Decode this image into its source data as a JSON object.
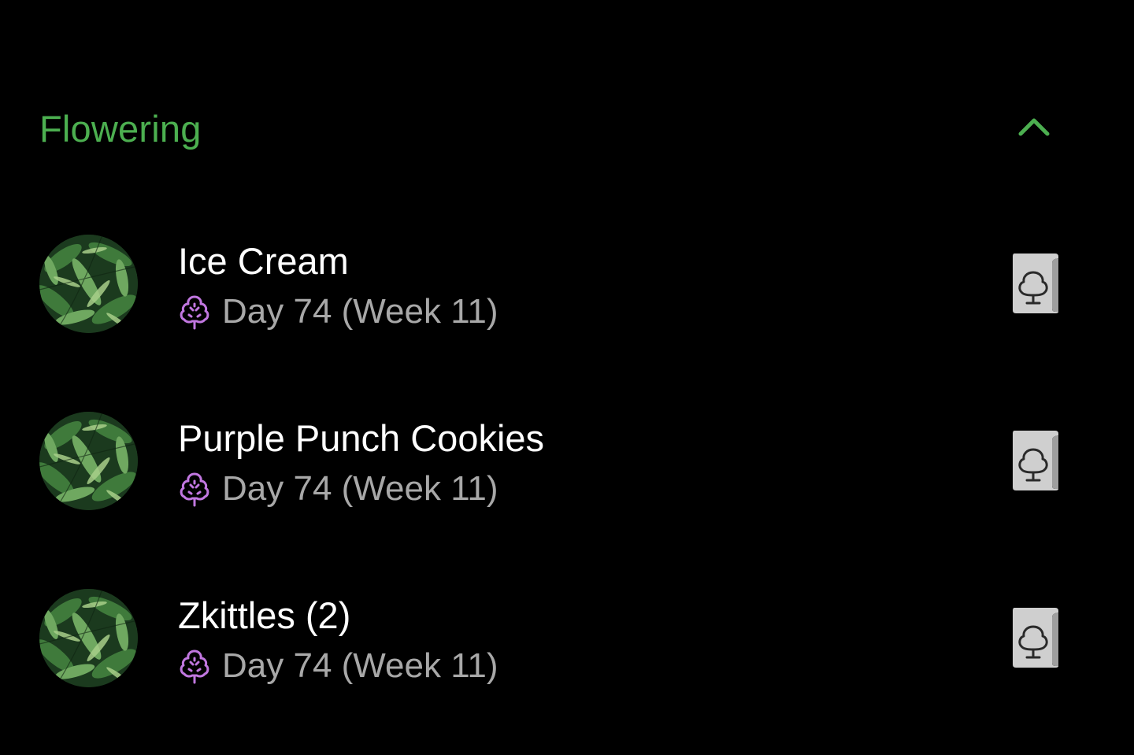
{
  "colors": {
    "background": "#000000",
    "accent_green": "#4caf50",
    "flowering_purple": "#c177e0",
    "secondary_text": "#a8a8a8",
    "diary_icon": "#cfcfcf"
  },
  "section": {
    "title": "Flowering",
    "toggle_icon": "chevron-up-icon"
  },
  "plants": [
    {
      "name": "Ice Cream",
      "status": "Day 74 (Week 11)",
      "stage_icon": "flowering-tree-icon",
      "action_icon": "diary-book-icon"
    },
    {
      "name": "Purple Punch Cookies",
      "status": "Day 74 (Week 11)",
      "stage_icon": "flowering-tree-icon",
      "action_icon": "diary-book-icon"
    },
    {
      "name": "Zkittles (2)",
      "status": "Day 74 (Week 11)",
      "stage_icon": "flowering-tree-icon",
      "action_icon": "diary-book-icon"
    }
  ]
}
